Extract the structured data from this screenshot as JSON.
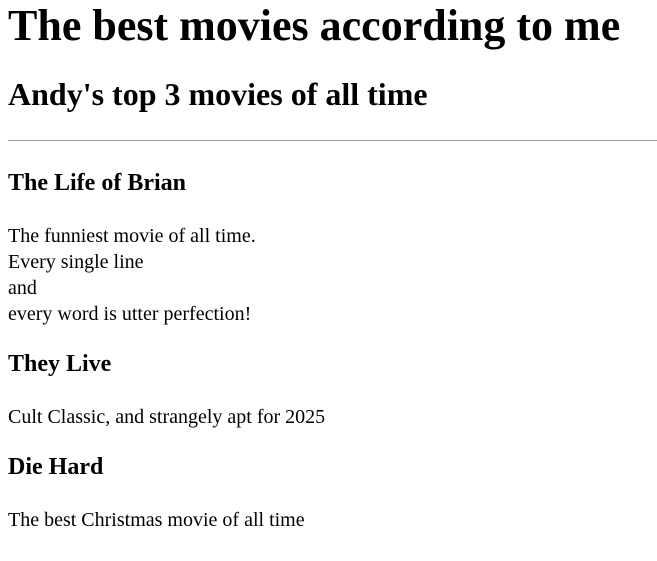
{
  "page": {
    "heading": "The best movies according to me",
    "subheading": "Andy's top 3 movies of all time"
  },
  "movies": [
    {
      "title": "The Life of Brian",
      "description_lines": [
        "The funniest movie of all time.",
        "Every single line",
        "and",
        "every word is utter perfection!"
      ]
    },
    {
      "title": "They Live",
      "description_lines": [
        "Cult Classic, and strangely apt for 2025"
      ]
    },
    {
      "title": "Die Hard",
      "description_lines": [
        "The best Christmas movie of all time"
      ]
    }
  ]
}
